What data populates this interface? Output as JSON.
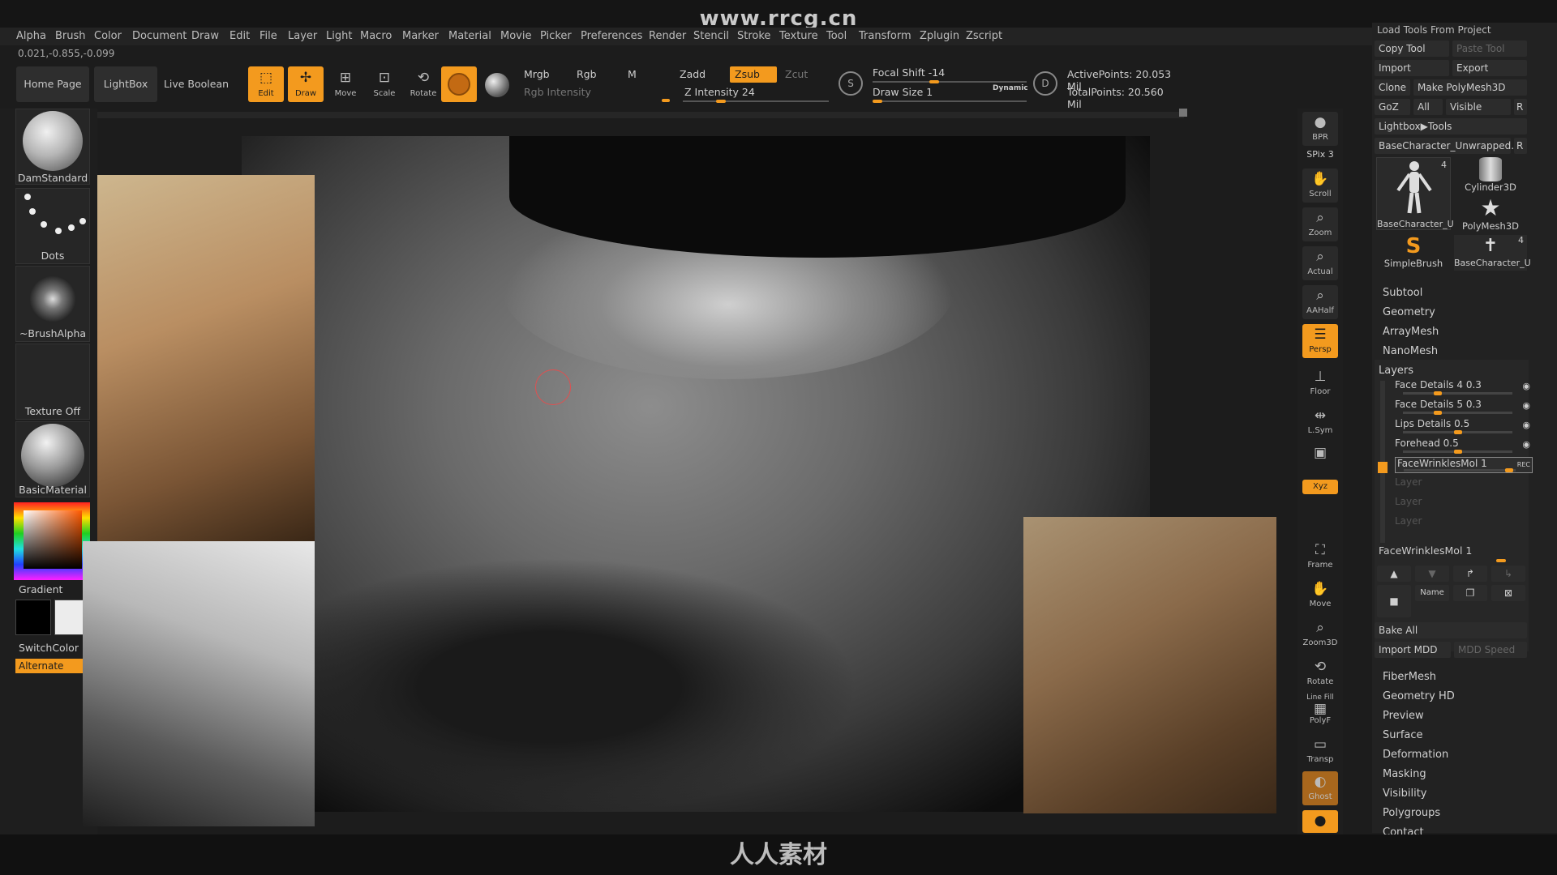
{
  "watermark": {
    "site": "www.rrcg.cn",
    "bottom": "人人素材"
  },
  "menu": [
    "Alpha",
    "Brush",
    "Color",
    "Document",
    "Draw",
    "Edit",
    "File",
    "Layer",
    "Light",
    "Macro",
    "Marker",
    "Material",
    "Movie",
    "Picker",
    "Preferences",
    "Render",
    "Stencil",
    "Stroke",
    "Texture",
    "Tool",
    "Transform",
    "Zplugin",
    "Zscript"
  ],
  "coords": "0.021,-0.855,-0.099",
  "toolbar": {
    "home_page": "Home Page",
    "lightbox": "LightBox",
    "live_boolean": "Live Boolean",
    "edit": "Edit",
    "draw": "Draw",
    "move": "Move",
    "scale": "Scale",
    "rotate": "Rotate",
    "mrgb": "Mrgb",
    "rgb": "Rgb",
    "m": "M",
    "rgb_intensity": "Rgb Intensity",
    "zadd": "Zadd",
    "zsub": "Zsub",
    "zcut": "Zcut",
    "z_intensity": "Z Intensity 24",
    "z_intensity_level": 0.24,
    "focal_shift": "Focal Shift -14",
    "draw_size": "Draw Size 1",
    "dynamic": "Dynamic",
    "active_points": "ActivePoints: 20.053 Mil",
    "total_points": "TotalPoints: 20.560 Mil"
  },
  "left_shelf": {
    "brush": "DamStandard",
    "stroke": "Dots",
    "alpha": "~BrushAlpha",
    "texture": "Texture Off",
    "material": "BasicMaterial",
    "gradient": "Gradient",
    "switch_color": "SwitchColor",
    "alternate": "Alternate"
  },
  "right_strip": [
    {
      "label": "BPR",
      "icon": "sphere-icon"
    },
    {
      "label": "SPix 3",
      "icon": ""
    },
    {
      "label": "Scroll",
      "icon": "hand-icon"
    },
    {
      "label": "Zoom",
      "icon": "zoom-icon"
    },
    {
      "label": "Actual",
      "icon": "zoom-icon"
    },
    {
      "label": "AAHalf",
      "icon": "zoom-icon"
    },
    {
      "label": "Persp",
      "icon": "perspective-icon"
    },
    {
      "label": "Floor",
      "icon": "floor-icon"
    },
    {
      "label": "L.Sym",
      "icon": "symmetry-icon"
    },
    {
      "label": "",
      "icon": "lock-icon"
    },
    {
      "label": "Xyz",
      "icon": "axis-icon"
    },
    {
      "label": "Frame",
      "icon": "frame-icon"
    },
    {
      "label": "Move",
      "icon": "move-icon"
    },
    {
      "label": "Zoom3D",
      "icon": "zoom-icon"
    },
    {
      "label": "Rotate",
      "icon": "rotate-icon"
    },
    {
      "label": "PolyF",
      "icon": "polyframe-icon"
    },
    {
      "label": "Line Fill",
      "icon": ""
    },
    {
      "label": "Transp",
      "icon": "transparency-icon"
    },
    {
      "label": "Ghost",
      "icon": "ghost-icon"
    },
    {
      "label": "Solo",
      "icon": "solo-icon"
    }
  ],
  "tool_panel": {
    "load_tools": "Load Tools From Project",
    "copy_tool": "Copy Tool",
    "paste_tool": "Paste Tool",
    "import": "Import",
    "export": "Export",
    "clone": "Clone",
    "make_polymesh": "Make PolyMesh3D",
    "goz": "GoZ",
    "all": "All",
    "visible": "Visible",
    "r": "R",
    "lightbox_tools": "Lightbox▶Tools",
    "current_tool": "BaseCharacter_Unwrapped.",
    "tools": [
      {
        "name": "BaseCharacter_U",
        "count": "4"
      },
      {
        "name": "Cylinder3D",
        "count": ""
      },
      {
        "name": "PolyMesh3D",
        "count": ""
      },
      {
        "name": "SimpleBrush",
        "count": ""
      },
      {
        "name": "BaseCharacter_U",
        "count": "4"
      }
    ],
    "subtool": "Subtool",
    "geometry": "Geometry",
    "arraymesh": "ArrayMesh",
    "nanomesh": "NanoMesh",
    "layers_title": "Layers",
    "layers": [
      {
        "name": "Face Details 4",
        "value": "0.3",
        "level": 0.3
      },
      {
        "name": "Face Details 5",
        "value": "0.3",
        "level": 0.3
      },
      {
        "name": "Lips Details",
        "value": "0.5",
        "level": 0.5
      },
      {
        "name": "Forehead",
        "value": "0.5",
        "level": 0.5
      },
      {
        "name": "FaceWrinklesMol",
        "value": "1",
        "level": 1.0
      }
    ],
    "empty_layer": "Layer",
    "rec": "REC",
    "active_layer": "FaceWrinklesMol 1",
    "name_btn": "Name",
    "bake_all": "Bake All",
    "import_mdd": "Import MDD",
    "mdd_speed": "MDD Speed",
    "sections": [
      "FiberMesh",
      "Geometry HD",
      "Preview",
      "Surface",
      "Deformation",
      "Masking",
      "Visibility",
      "Polygroups",
      "Contact"
    ]
  }
}
